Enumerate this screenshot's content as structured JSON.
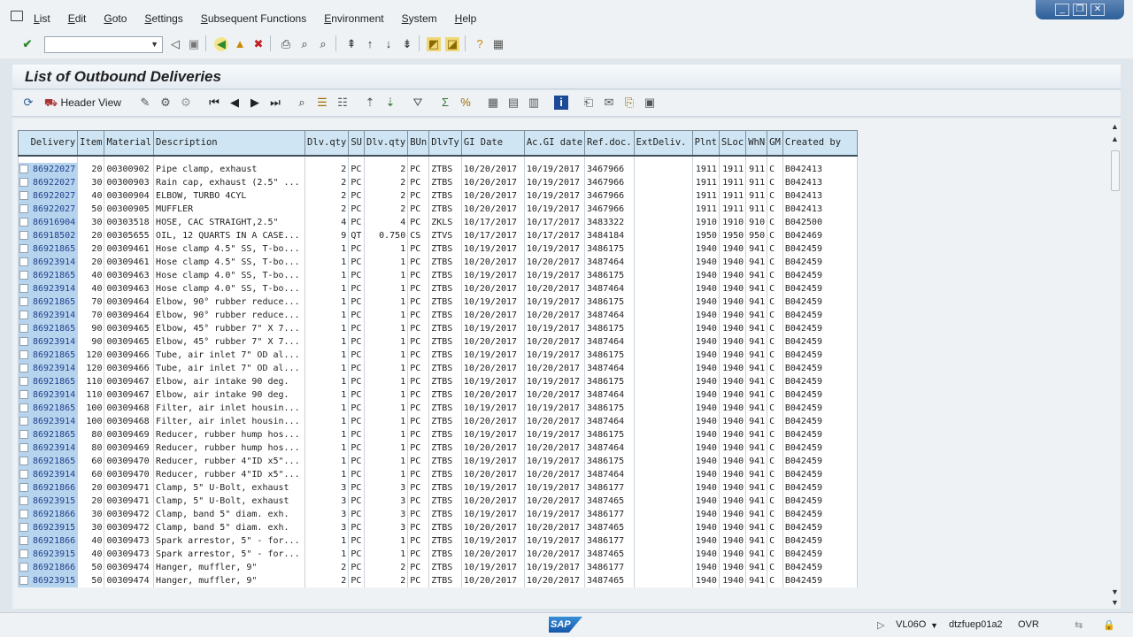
{
  "menubar": {
    "items": [
      "List",
      "Edit",
      "Goto",
      "Settings",
      "Subsequent Functions",
      "Environment",
      "System",
      "Help"
    ]
  },
  "command_field": {
    "value": ""
  },
  "title": "List of Outbound Deliveries",
  "app_toolbar": {
    "header_view_label": "Header View"
  },
  "table": {
    "columns": [
      "Delivery",
      "Item",
      "Material",
      "Description",
      "Dlv.qty",
      "SU",
      "Dlv.qty",
      "BUn",
      "DlvTy",
      "GI Date",
      "Ac.GI date",
      "Ref.doc.",
      "ExtDeliv.",
      "Plnt",
      "SLoc",
      "WhN",
      "GM",
      "Created by"
    ],
    "rows": [
      [
        "86922027",
        "20",
        "00300902",
        "Pipe clamp, exhaust",
        "2",
        "PC",
        "2",
        "PC",
        "ZTBS",
        "10/20/2017",
        "10/19/2017",
        "3467966",
        "",
        "1911",
        "1911",
        "911",
        "C",
        "B042413"
      ],
      [
        "86922027",
        "30",
        "00300903",
        "Rain cap, exhaust (2.5\" ...",
        "2",
        "PC",
        "2",
        "PC",
        "ZTBS",
        "10/20/2017",
        "10/19/2017",
        "3467966",
        "",
        "1911",
        "1911",
        "911",
        "C",
        "B042413"
      ],
      [
        "86922027",
        "40",
        "00300904",
        "ELBOW, TURBO 4CYL",
        "2",
        "PC",
        "2",
        "PC",
        "ZTBS",
        "10/20/2017",
        "10/19/2017",
        "3467966",
        "",
        "1911",
        "1911",
        "911",
        "C",
        "B042413"
      ],
      [
        "86922027",
        "50",
        "00300905",
        "MUFFLER",
        "2",
        "PC",
        "2",
        "PC",
        "ZTBS",
        "10/20/2017",
        "10/19/2017",
        "3467966",
        "",
        "1911",
        "1911",
        "911",
        "C",
        "B042413"
      ],
      [
        "86916904",
        "30",
        "00303518",
        "HOSE, CAC STRAIGHT,2.5\"",
        "4",
        "PC",
        "4",
        "PC",
        "ZKLS",
        "10/17/2017",
        "10/17/2017",
        "3483322",
        "",
        "1910",
        "1910",
        "910",
        "C",
        "B042500"
      ],
      [
        "86918502",
        "20",
        "00305655",
        "OIL, 12 QUARTS IN A CASE...",
        "9",
        "QT",
        "0.750",
        "CS",
        "ZTVS",
        "10/17/2017",
        "10/17/2017",
        "3484184",
        "",
        "1950",
        "1950",
        "950",
        "C",
        "B042469"
      ],
      [
        "86921865",
        "20",
        "00309461",
        "Hose clamp 4.5\" SS, T-bo...",
        "1",
        "PC",
        "1",
        "PC",
        "ZTBS",
        "10/19/2017",
        "10/19/2017",
        "3486175",
        "",
        "1940",
        "1940",
        "941",
        "C",
        "B042459"
      ],
      [
        "86923914",
        "20",
        "00309461",
        "Hose clamp 4.5\" SS, T-bo...",
        "1",
        "PC",
        "1",
        "PC",
        "ZTBS",
        "10/20/2017",
        "10/20/2017",
        "3487464",
        "",
        "1940",
        "1940",
        "941",
        "C",
        "B042459"
      ],
      [
        "86921865",
        "40",
        "00309463",
        "Hose clamp 4.0\" SS, T-bo...",
        "1",
        "PC",
        "1",
        "PC",
        "ZTBS",
        "10/19/2017",
        "10/19/2017",
        "3486175",
        "",
        "1940",
        "1940",
        "941",
        "C",
        "B042459"
      ],
      [
        "86923914",
        "40",
        "00309463",
        "Hose clamp 4.0\" SS, T-bo...",
        "1",
        "PC",
        "1",
        "PC",
        "ZTBS",
        "10/20/2017",
        "10/20/2017",
        "3487464",
        "",
        "1940",
        "1940",
        "941",
        "C",
        "B042459"
      ],
      [
        "86921865",
        "70",
        "00309464",
        "Elbow, 90° rubber reduce...",
        "1",
        "PC",
        "1",
        "PC",
        "ZTBS",
        "10/19/2017",
        "10/19/2017",
        "3486175",
        "",
        "1940",
        "1940",
        "941",
        "C",
        "B042459"
      ],
      [
        "86923914",
        "70",
        "00309464",
        "Elbow, 90° rubber reduce...",
        "1",
        "PC",
        "1",
        "PC",
        "ZTBS",
        "10/20/2017",
        "10/20/2017",
        "3487464",
        "",
        "1940",
        "1940",
        "941",
        "C",
        "B042459"
      ],
      [
        "86921865",
        "90",
        "00309465",
        "Elbow, 45° rubber 7\" X 7...",
        "1",
        "PC",
        "1",
        "PC",
        "ZTBS",
        "10/19/2017",
        "10/19/2017",
        "3486175",
        "",
        "1940",
        "1940",
        "941",
        "C",
        "B042459"
      ],
      [
        "86923914",
        "90",
        "00309465",
        "Elbow, 45° rubber 7\" X 7...",
        "1",
        "PC",
        "1",
        "PC",
        "ZTBS",
        "10/20/2017",
        "10/20/2017",
        "3487464",
        "",
        "1940",
        "1940",
        "941",
        "C",
        "B042459"
      ],
      [
        "86921865",
        "120",
        "00309466",
        "Tube, air inlet 7\" OD al...",
        "1",
        "PC",
        "1",
        "PC",
        "ZTBS",
        "10/19/2017",
        "10/19/2017",
        "3486175",
        "",
        "1940",
        "1940",
        "941",
        "C",
        "B042459"
      ],
      [
        "86923914",
        "120",
        "00309466",
        "Tube, air inlet 7\" OD al...",
        "1",
        "PC",
        "1",
        "PC",
        "ZTBS",
        "10/20/2017",
        "10/20/2017",
        "3487464",
        "",
        "1940",
        "1940",
        "941",
        "C",
        "B042459"
      ],
      [
        "86921865",
        "110",
        "00309467",
        "Elbow, air intake 90 deg.",
        "1",
        "PC",
        "1",
        "PC",
        "ZTBS",
        "10/19/2017",
        "10/19/2017",
        "3486175",
        "",
        "1940",
        "1940",
        "941",
        "C",
        "B042459"
      ],
      [
        "86923914",
        "110",
        "00309467",
        "Elbow, air intake 90 deg.",
        "1",
        "PC",
        "1",
        "PC",
        "ZTBS",
        "10/20/2017",
        "10/20/2017",
        "3487464",
        "",
        "1940",
        "1940",
        "941",
        "C",
        "B042459"
      ],
      [
        "86921865",
        "100",
        "00309468",
        "Filter, air inlet housin...",
        "1",
        "PC",
        "1",
        "PC",
        "ZTBS",
        "10/19/2017",
        "10/19/2017",
        "3486175",
        "",
        "1940",
        "1940",
        "941",
        "C",
        "B042459"
      ],
      [
        "86923914",
        "100",
        "00309468",
        "Filter, air inlet housin...",
        "1",
        "PC",
        "1",
        "PC",
        "ZTBS",
        "10/20/2017",
        "10/20/2017",
        "3487464",
        "",
        "1940",
        "1940",
        "941",
        "C",
        "B042459"
      ],
      [
        "86921865",
        "80",
        "00309469",
        "Reducer, rubber hump hos...",
        "1",
        "PC",
        "1",
        "PC",
        "ZTBS",
        "10/19/2017",
        "10/19/2017",
        "3486175",
        "",
        "1940",
        "1940",
        "941",
        "C",
        "B042459"
      ],
      [
        "86923914",
        "80",
        "00309469",
        "Reducer, rubber hump hos...",
        "1",
        "PC",
        "1",
        "PC",
        "ZTBS",
        "10/20/2017",
        "10/20/2017",
        "3487464",
        "",
        "1940",
        "1940",
        "941",
        "C",
        "B042459"
      ],
      [
        "86921865",
        "60",
        "00309470",
        "Reducer, rubber 4\"ID x5\"...",
        "1",
        "PC",
        "1",
        "PC",
        "ZTBS",
        "10/19/2017",
        "10/19/2017",
        "3486175",
        "",
        "1940",
        "1940",
        "941",
        "C",
        "B042459"
      ],
      [
        "86923914",
        "60",
        "00309470",
        "Reducer, rubber 4\"ID x5\"...",
        "1",
        "PC",
        "1",
        "PC",
        "ZTBS",
        "10/20/2017",
        "10/20/2017",
        "3487464",
        "",
        "1940",
        "1940",
        "941",
        "C",
        "B042459"
      ],
      [
        "86921866",
        "20",
        "00309471",
        "Clamp, 5\" U-Bolt, exhaust",
        "3",
        "PC",
        "3",
        "PC",
        "ZTBS",
        "10/19/2017",
        "10/19/2017",
        "3486177",
        "",
        "1940",
        "1940",
        "941",
        "C",
        "B042459"
      ],
      [
        "86923915",
        "20",
        "00309471",
        "Clamp, 5\" U-Bolt, exhaust",
        "3",
        "PC",
        "3",
        "PC",
        "ZTBS",
        "10/20/2017",
        "10/20/2017",
        "3487465",
        "",
        "1940",
        "1940",
        "941",
        "C",
        "B042459"
      ],
      [
        "86921866",
        "30",
        "00309472",
        "Clamp, band 5\" diam. exh.",
        "3",
        "PC",
        "3",
        "PC",
        "ZTBS",
        "10/19/2017",
        "10/19/2017",
        "3486177",
        "",
        "1940",
        "1940",
        "941",
        "C",
        "B042459"
      ],
      [
        "86923915",
        "30",
        "00309472",
        "Clamp, band 5\" diam. exh.",
        "3",
        "PC",
        "3",
        "PC",
        "ZTBS",
        "10/20/2017",
        "10/20/2017",
        "3487465",
        "",
        "1940",
        "1940",
        "941",
        "C",
        "B042459"
      ],
      [
        "86921866",
        "40",
        "00309473",
        "Spark arrestor, 5\" - for...",
        "1",
        "PC",
        "1",
        "PC",
        "ZTBS",
        "10/19/2017",
        "10/19/2017",
        "3486177",
        "",
        "1940",
        "1940",
        "941",
        "C",
        "B042459"
      ],
      [
        "86923915",
        "40",
        "00309473",
        "Spark arrestor, 5\" - for...",
        "1",
        "PC",
        "1",
        "PC",
        "ZTBS",
        "10/20/2017",
        "10/20/2017",
        "3487465",
        "",
        "1940",
        "1940",
        "941",
        "C",
        "B042459"
      ],
      [
        "86921866",
        "50",
        "00309474",
        "Hanger, muffler, 9\"",
        "2",
        "PC",
        "2",
        "PC",
        "ZTBS",
        "10/19/2017",
        "10/19/2017",
        "3486177",
        "",
        "1940",
        "1940",
        "941",
        "C",
        "B042459"
      ],
      [
        "86923915",
        "50",
        "00309474",
        "Hanger, muffler, 9\"",
        "2",
        "PC",
        "2",
        "PC",
        "ZTBS",
        "10/20/2017",
        "10/20/2017",
        "3487465",
        "",
        "1940",
        "1940",
        "941",
        "C",
        "B042459"
      ]
    ]
  },
  "statusbar": {
    "logo": "SAP",
    "transaction": "VL06O",
    "server": "dtzfuep01a2",
    "mode": "OVR"
  }
}
